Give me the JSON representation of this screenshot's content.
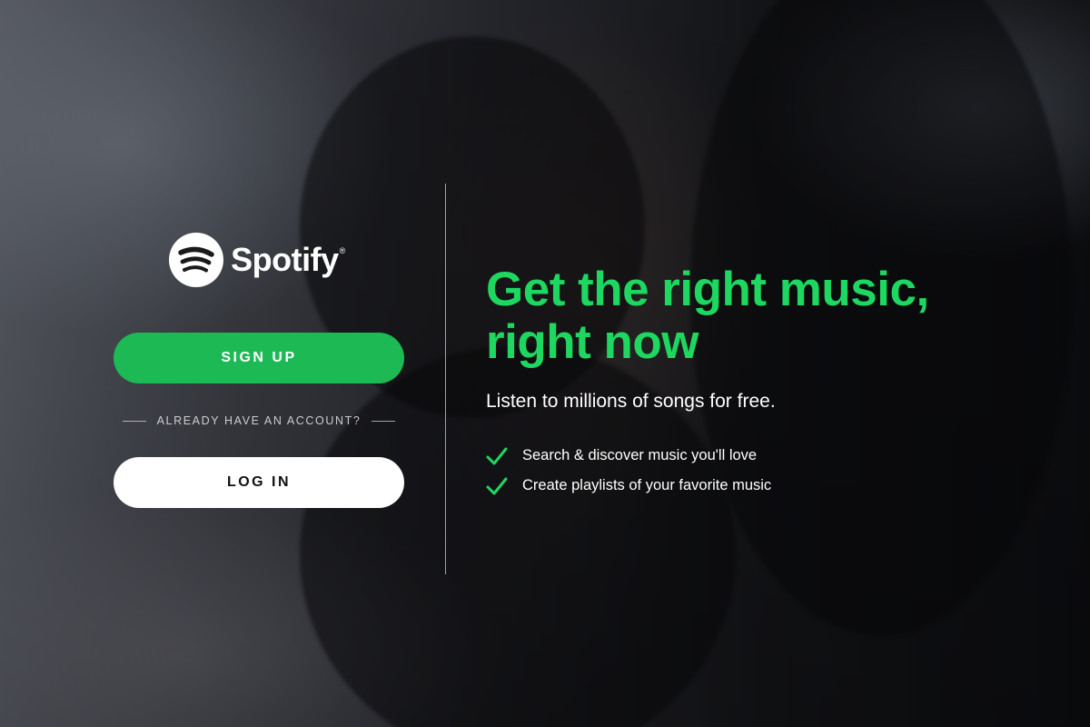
{
  "brand": {
    "name": "Spotify",
    "registered_mark": "®",
    "logo_icon": "spotify-wave-icon"
  },
  "auth": {
    "signup_label": "SIGN UP",
    "divider_text": "ALREADY HAVE AN ACCOUNT?",
    "login_label": "LOG IN"
  },
  "hero": {
    "headline_line1": "Get the right music,",
    "headline_line2": "right now",
    "subtitle": "Listen to millions of songs for free.",
    "features": [
      {
        "icon": "check-icon",
        "text": "Search & discover music you'll love"
      },
      {
        "icon": "check-icon",
        "text": "Create playlists of your favorite music"
      }
    ]
  },
  "colors": {
    "accent_green": "#1ed760",
    "button_green": "#1db954",
    "white": "#ffffff"
  }
}
